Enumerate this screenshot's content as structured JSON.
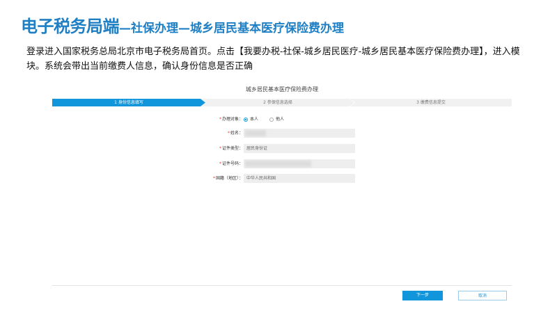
{
  "slide": {
    "title_main": "电子税务局端",
    "title_sub": "—社保办理—城乡居民基本医疗保险费办理",
    "description": "登录进入国家税务总局北京市电子税务局首页。点击【我要办税-社保-城乡居民医疗-城乡居民基本医疗保险费办理】，进入模块。系统会带出当前缴费人信息，确认身份信息是否正确"
  },
  "form": {
    "title": "城乡居民基本医疗保险费办理",
    "steps": [
      "1 身份信息填写",
      "2 参保信息选择",
      "3 缴费信息提交"
    ],
    "active_step": 1,
    "fields": {
      "target": {
        "label": "办理对象：",
        "options": [
          "本人",
          "他人"
        ],
        "selected": "本人"
      },
      "name": {
        "label": "姓名：",
        "value": ""
      },
      "id_type": {
        "label": "证件类型：",
        "value": "居民身份证"
      },
      "id_number": {
        "label": "证件号码：",
        "value": ""
      },
      "nationality": {
        "label": "国籍（地区）：",
        "value": "中华人民共和国"
      }
    },
    "required_mark": "*",
    "buttons": {
      "next": "下一步",
      "cancel": "取消"
    }
  },
  "colors": {
    "title": "#1e7fc4",
    "accent": "#1296db",
    "required": "#e33333"
  }
}
